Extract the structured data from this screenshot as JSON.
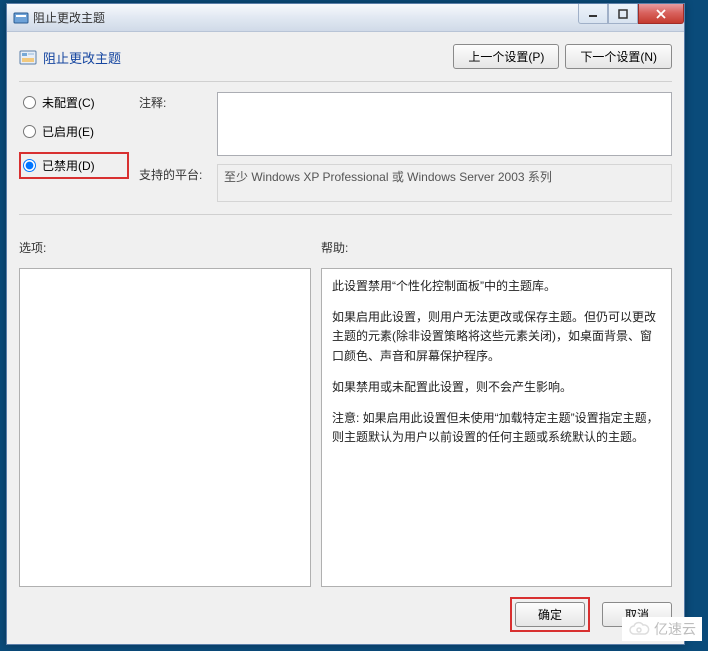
{
  "window": {
    "title": "阻止更改主题"
  },
  "header": {
    "policy_title": "阻止更改主题",
    "prev_setting_label": "上一个设置(P)",
    "next_setting_label": "下一个设置(N)"
  },
  "radios": {
    "not_configured": "未配置(C)",
    "enabled": "已启用(E)",
    "disabled": "已禁用(D)",
    "selected": "disabled"
  },
  "fields": {
    "comment_label": "注释:",
    "comment_value": "",
    "platform_label": "支持的平台:",
    "platform_value": "至少 Windows XP Professional 或 Windows Server 2003 系列"
  },
  "columns": {
    "options_label": "选项:",
    "help_label": "帮助:"
  },
  "help": {
    "p1": "此设置禁用“个性化控制面板”中的主题库。",
    "p2": "如果启用此设置，则用户无法更改或保存主题。但仍可以更改主题的元素(除非设置策略将这些元素关闭)，如桌面背景、窗口颜色、声音和屏幕保护程序。",
    "p3": "如果禁用或未配置此设置，则不会产生影响。",
    "p4": "注意: 如果启用此设置但未使用“加载特定主题”设置指定主题，则主题默认为用户以前设置的任何主题或系统默认的主题。"
  },
  "footer": {
    "ok_label": "确定",
    "cancel_label": "取消"
  },
  "watermark": {
    "text": "亿速云"
  }
}
